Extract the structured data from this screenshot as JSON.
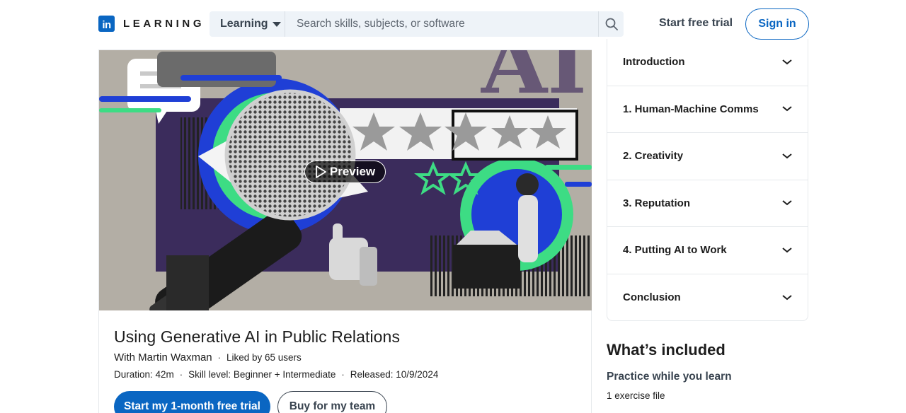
{
  "header": {
    "logo_letters": "in",
    "logo_word": "LEARNING",
    "search_scope": "Learning",
    "search_placeholder": "Search skills, subjects, or software",
    "start_trial": "Start free trial",
    "sign_in": "Sign in"
  },
  "video": {
    "preview_label": "Preview",
    "thumbnail_text": "AI"
  },
  "course": {
    "title": "Using Generative AI in Public Relations",
    "author": "With Martin Waxman",
    "likes": "Liked by 65 users",
    "duration": "Duration: 42m",
    "skill_level": "Skill level: Beginner + Intermediate",
    "released": "Released: 10/9/2024"
  },
  "actions": {
    "primary": "Start my 1-month free trial",
    "secondary": "Buy for my team"
  },
  "toc": {
    "items": [
      {
        "label": "Introduction"
      },
      {
        "label": "1. Human-Machine Comms"
      },
      {
        "label": "2. Creativity"
      },
      {
        "label": "3. Reputation"
      },
      {
        "label": "4. Putting AI to Work"
      },
      {
        "label": "Conclusion"
      }
    ]
  },
  "included": {
    "title": "What’s included",
    "subtitle": "Practice while you learn",
    "detail": "1 exercise file"
  },
  "colors": {
    "brand": "#0a66c2",
    "text": "#1d1d1d",
    "secondary_text": "#38434f",
    "search_bg": "#eef3f8",
    "thumb_purple": "#3b2c5c",
    "thumb_green": "#3ddc84"
  },
  "icons": [
    "linkedin-logo-icon",
    "caret-down-icon",
    "search-icon",
    "play-icon",
    "chevron-down-icon"
  ]
}
